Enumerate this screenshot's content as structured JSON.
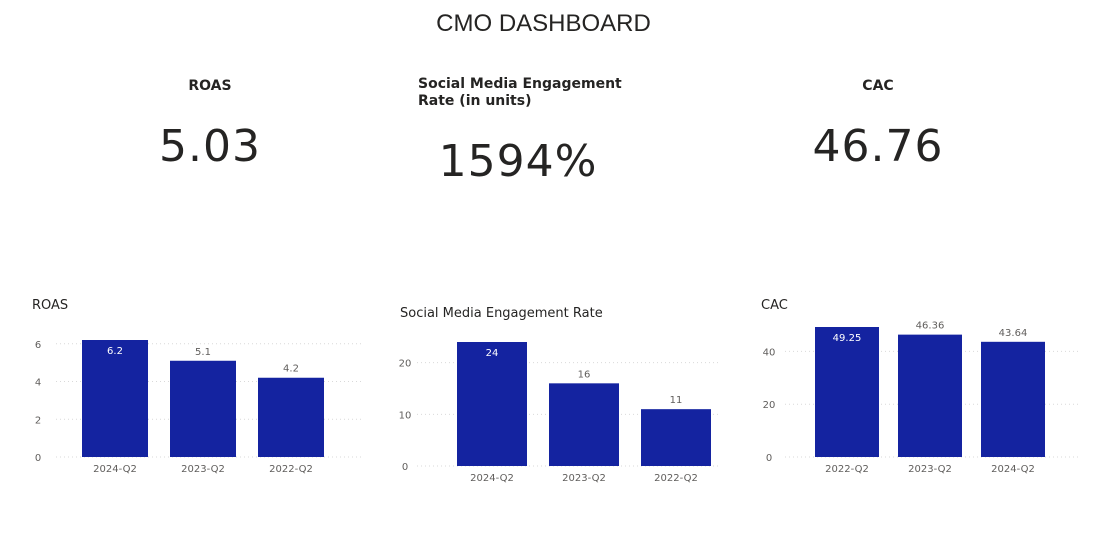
{
  "dashboard": {
    "title": "CMO DASHBOARD"
  },
  "cards": [
    {
      "label": "ROAS",
      "value": "5.03"
    },
    {
      "label": "Social Media Engagement Rate (in units)",
      "value": "1594%"
    },
    {
      "label": "CAC",
      "value": "46.76"
    }
  ],
  "colors": {
    "bar": "#1423a0",
    "inside_label": "#ffffff",
    "outside_label": "#605e5c",
    "grid": "#d9d9d9",
    "axis_text": "#605e5c"
  },
  "chart_data": [
    {
      "type": "bar",
      "title": "ROAS",
      "categories": [
        "2024-Q2",
        "2023-Q2",
        "2022-Q2"
      ],
      "values": [
        6.2,
        5.1,
        4.2
      ],
      "value_labels": [
        "6.2",
        "5.1",
        "4.2"
      ],
      "yticks": [
        "0",
        "2",
        "4",
        "6"
      ],
      "ylim": [
        0,
        6.2
      ],
      "grid": true
    },
    {
      "type": "bar",
      "title": "Social Media Engagement Rate",
      "categories": [
        "2024-Q2",
        "2023-Q2",
        "2022-Q2"
      ],
      "values": [
        24,
        16,
        11
      ],
      "value_labels": [
        "24",
        "16",
        "11"
      ],
      "yticks": [
        "0",
        "10",
        "20"
      ],
      "ylim": [
        0,
        24
      ],
      "grid": true
    },
    {
      "type": "bar",
      "title": "CAC",
      "categories": [
        "2022-Q2",
        "2023-Q2",
        "2024-Q2"
      ],
      "values": [
        49.25,
        46.36,
        43.64
      ],
      "value_labels": [
        "49.25",
        "46.36",
        "43.64"
      ],
      "yticks": [
        "0",
        "20",
        "40"
      ],
      "ylim": [
        0,
        49.25
      ],
      "grid": true
    }
  ]
}
